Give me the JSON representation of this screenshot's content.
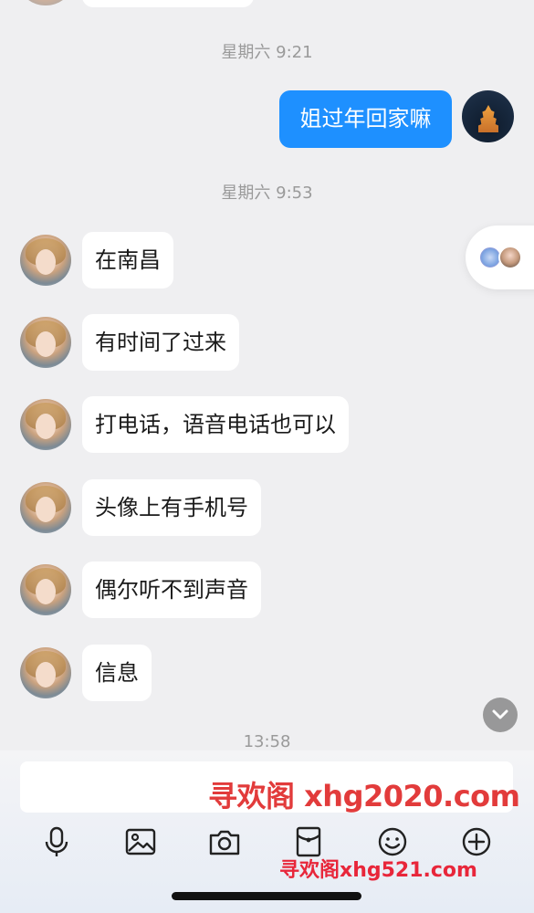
{
  "timestamps": {
    "t1": "星期六 9:21",
    "t2": "星期六 9:53",
    "t3": "13:58"
  },
  "sent_message": "姐过年回家嘛",
  "received_messages": [
    "在南昌",
    "有时间了过来",
    "打电话，语音电话也可以",
    "头像上有手机号",
    "偶尔听不到声音",
    "信息"
  ],
  "watermarks": {
    "input_overlay": "寻欢阁 xhg2020.com",
    "bottom_overlay": "寻欢阁xhg521.com"
  },
  "toolbar": {
    "icons": [
      "microphone-icon",
      "image-icon",
      "camera-icon",
      "red-packet-icon",
      "emoji-icon",
      "plus-icon"
    ]
  },
  "colors": {
    "sent_bubble": "#1e90ff",
    "received_bubble": "#ffffff",
    "background": "#efeff1",
    "watermark": "#e23b3b"
  }
}
